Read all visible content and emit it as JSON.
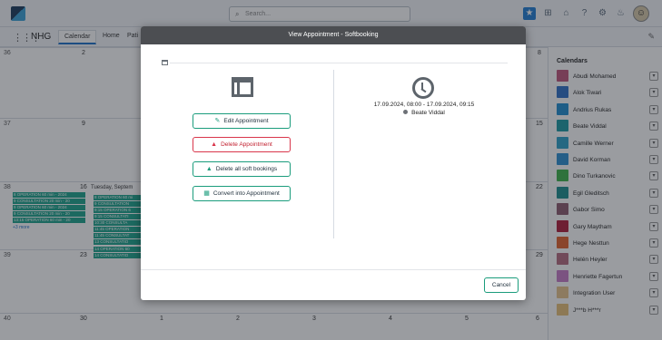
{
  "topbar": {
    "search_placeholder": "Search..."
  },
  "appbar": {
    "app_name": "NHG",
    "tabs": [
      {
        "label": "Calendar"
      },
      {
        "label": "Home"
      },
      {
        "label": "Pati"
      }
    ]
  },
  "calendar": {
    "week_numbers": [
      "36",
      "37",
      "38",
      "39",
      "40"
    ],
    "row_start_days": [
      "2",
      "9",
      "16",
      "23",
      "30"
    ],
    "right_days": [
      "8",
      "15",
      "22",
      "29",
      ""
    ],
    "bottom_days": [
      "1",
      "2",
      "3",
      "4",
      "5",
      "6"
    ],
    "row38_events": [
      "8 OPERATION 60 min - 2024",
      "9 CONSULTATION 20 min - 20",
      "9 OPERATION 60 min - 2024",
      "9 CONSULTATION 20 min - 20",
      "13:15 OPERATION 60 min - 20"
    ],
    "row38_more": "+3 more",
    "day_label": "Tuesday, Septem",
    "day_events": [
      "8 OPERATION 60 mi",
      "9 CONSULTATION",
      "9:15 OPERATION 6",
      "9:15 CONSULTATI",
      "10:30 CONSULTA",
      "11:45 OPERATION",
      "11:45 CONSULTAT",
      "13 CONSULTATIO",
      "14 OPERATION 60",
      "14 CONSULTATIO"
    ]
  },
  "calendars_panel": {
    "title": "Calendars",
    "items": [
      {
        "name": "Abudi Mohamed",
        "color": "#c0547a"
      },
      {
        "name": "Alok Tiwari",
        "color": "#2f6fc6"
      },
      {
        "name": "Andrius Rukas",
        "color": "#1e8ccf"
      },
      {
        "name": "Beate Viddal",
        "color": "#1a9aa3"
      },
      {
        "name": "Camille Werner",
        "color": "#2aa1c9"
      },
      {
        "name": "David Korman",
        "color": "#2b8ed1"
      },
      {
        "name": "Dino Turkanovic",
        "color": "#3db34a"
      },
      {
        "name": "Egil Gleditsch",
        "color": "#1a8c8c"
      },
      {
        "name": "Gabor Simo",
        "color": "#8c5a6e"
      },
      {
        "name": "Gary Maytham",
        "color": "#b01c3a"
      },
      {
        "name": "Hege Nesttun",
        "color": "#e2622a"
      },
      {
        "name": "Helén Heyler",
        "color": "#b56b7e"
      },
      {
        "name": "Henriette Fagertun",
        "color": "#c77ac6"
      },
      {
        "name": "Integration User",
        "color": "#e7c38a"
      },
      {
        "name": "J***b H***r",
        "color": "#e7bf77"
      }
    ]
  },
  "modal": {
    "title": "View Appointment - Softbooking",
    "buttons": {
      "edit": "Edit Appointment",
      "delete": "Delete Appointment",
      "delete_all": "Delete all soft bookings",
      "convert": "Convert into Appointment"
    },
    "time_range": "17.09.2024, 08:00 - 17.09.2024, 09:15",
    "attendee": "Beate Viddal",
    "cancel": "Cancel"
  }
}
